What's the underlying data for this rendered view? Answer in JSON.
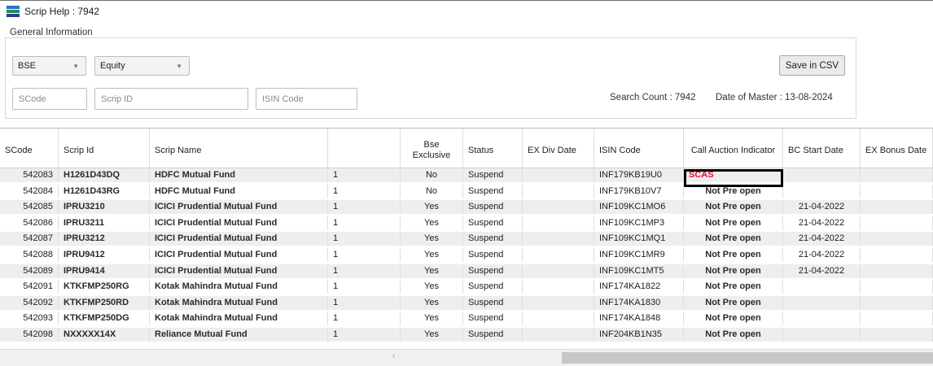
{
  "window": {
    "title": "Scrip Help : 7942"
  },
  "general": {
    "legend": "General Information",
    "exchange": "BSE",
    "segment": "Equity",
    "scode_placeholder": "SCode",
    "scripid_placeholder": "Scrip ID",
    "isin_placeholder": "ISIN Code",
    "save_label": "Save in CSV",
    "search_count": "Search Count : 7942",
    "date_master": "Date of Master : 13-08-2024"
  },
  "columns": [
    "SCode",
    "Scrip Id",
    "Scrip Name",
    "",
    "Bse Exclusive",
    "Status",
    "EX Div Date",
    "ISIN Code",
    "Call Auction Indicator",
    "BC Start Date",
    "EX Bonus Date"
  ],
  "rows": [
    [
      "542083",
      "H1261D43DQ",
      "HDFC Mutual Fund",
      "1",
      "No",
      "Suspend",
      "",
      "INF179KB19U0",
      "SCAS",
      "",
      ""
    ],
    [
      "542084",
      "H1261D43RG",
      "HDFC Mutual Fund",
      "1",
      "No",
      "Suspend",
      "",
      "INF179KB10V7",
      "Not Pre open",
      "",
      ""
    ],
    [
      "542085",
      "IPRU3210",
      "ICICI Prudential Mutual Fund",
      "1",
      "Yes",
      "Suspend",
      "",
      "INF109KC1MO6",
      "Not Pre open",
      "21-04-2022",
      ""
    ],
    [
      "542086",
      "IPRU3211",
      "ICICI Prudential Mutual Fund",
      "1",
      "Yes",
      "Suspend",
      "",
      "INF109KC1MP3",
      "Not Pre open",
      "21-04-2022",
      ""
    ],
    [
      "542087",
      "IPRU3212",
      "ICICI Prudential Mutual Fund",
      "1",
      "Yes",
      "Suspend",
      "",
      "INF109KC1MQ1",
      "Not Pre open",
      "21-04-2022",
      ""
    ],
    [
      "542088",
      "IPRU9412",
      "ICICI Prudential Mutual Fund",
      "1",
      "Yes",
      "Suspend",
      "",
      "INF109KC1MR9",
      "Not Pre open",
      "21-04-2022",
      ""
    ],
    [
      "542089",
      "IPRU9414",
      "ICICI Prudential Mutual Fund",
      "1",
      "Yes",
      "Suspend",
      "",
      "INF109KC1MT5",
      "Not Pre open",
      "21-04-2022",
      ""
    ],
    [
      "542091",
      "KTKFMP250RG",
      "Kotak Mahindra Mutual Fund",
      "1",
      "Yes",
      "Suspend",
      "",
      "INF174KA1822",
      "Not Pre open",
      "",
      ""
    ],
    [
      "542092",
      "KTKFMP250RD",
      "Kotak Mahindra Mutual Fund",
      "1",
      "Yes",
      "Suspend",
      "",
      "INF174KA1830",
      "Not Pre open",
      "",
      ""
    ],
    [
      "542093",
      "KTKFMP250DG",
      "Kotak Mahindra Mutual Fund",
      "1",
      "Yes",
      "Suspend",
      "",
      "INF174KA1848",
      "Not Pre open",
      "",
      ""
    ],
    [
      "542098",
      "NXXXXX14X",
      "Reliance Mutual Fund",
      "1",
      "Yes",
      "Suspend",
      "",
      "INF204KB1N35",
      "Not Pre open",
      "",
      ""
    ]
  ],
  "scroll": {
    "left_arrow": "‹"
  },
  "colors": {
    "highlight_text": "#e0103a",
    "row_alt": "#eeeeee"
  }
}
